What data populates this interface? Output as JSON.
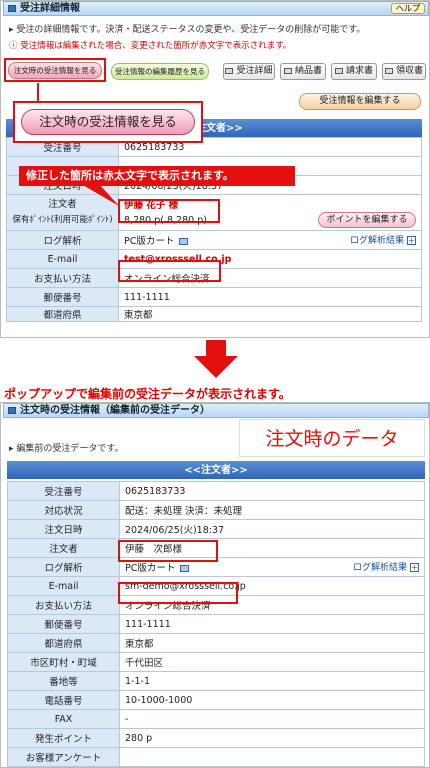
{
  "top": {
    "title": "受注詳細情報",
    "help": "ヘルプ",
    "desc": "受注の詳細情報です。決済・配送ステータスの変更や、受注データの削除が可能です。",
    "warn": "受注情報は編集された場合、変更された箇所が赤文字で表示されます。",
    "buttons": {
      "view_original": "注文時の受注情報を見る",
      "history": "受注情報の編集履歴を見る",
      "print_detail": "受注詳細",
      "print_delivery": "納品書",
      "print_invoice": "請求書",
      "print_receipt": "領収書",
      "edit": "受注情報を編集する"
    },
    "zoom_label": "注文時の受注情報を見る",
    "header_partial": "注文者>>",
    "callout": "修正した箇所は赤太文字で表示されます。",
    "rows": {
      "order_no_label": "受注番号",
      "order_no": "0625183733",
      "date_label": "注文日時",
      "date_partial": "2024/06/25(火)18:37",
      "orderer_label": "注文者",
      "orderer": "伊藤 花子 様",
      "point_label": "保有ﾎﾟｲﾝﾄ(利用可能ﾎﾟｲﾝﾄ)",
      "point": "8,280 p( 8,280 p)",
      "point_btn": "ポイントを編集する",
      "log_label": "ログ解析",
      "log": "PC版カート",
      "log_btn": "ログ解析結果",
      "email_label": "E-mail",
      "email": "test@xrosssell.co.jp",
      "pay_label": "お支払い方法",
      "pay": "オンライン総合決済",
      "zip_label": "郵便番号",
      "zip": "111-1111",
      "pref_label": "都道府県",
      "pref": "東京都"
    }
  },
  "middle": {
    "caption": "ポップアップで編集前の受注データが表示されます。"
  },
  "popup": {
    "title": "注文時の受注情報（編集前の受注データ）",
    "desc": "編集前の受注データです。",
    "badge": "注文時のデータ",
    "header": "<<注文者>>",
    "rows": [
      {
        "label": "受注番号",
        "value": "0625183733"
      },
      {
        "label": "対応状況",
        "value": "配送：未処理 決済：未処理"
      },
      {
        "label": "注文日時",
        "value": "2024/06/25(火)18:37"
      },
      {
        "label": "注文者",
        "value": "伊藤　次郎様"
      },
      {
        "label": "ログ解析",
        "value": "PC版カート"
      },
      {
        "label": "E-mail",
        "value": "sm-demo@xrosssell.co.jp"
      },
      {
        "label": "お支払い方法",
        "value": "オンライン総合決済"
      },
      {
        "label": "郵便番号",
        "value": "111-1111"
      },
      {
        "label": "都道府県",
        "value": "東京都"
      },
      {
        "label": "市区町村・町域",
        "value": "千代田区"
      },
      {
        "label": "番地等",
        "value": "1-1-1"
      },
      {
        "label": "電話番号",
        "value": "10-1000-1000"
      },
      {
        "label": "FAX",
        "value": "-"
      },
      {
        "label": "発生ポイント",
        "value": "280 p"
      },
      {
        "label": "お客様アンケート",
        "value": ""
      }
    ],
    "log_btn": "ログ解析結果"
  }
}
